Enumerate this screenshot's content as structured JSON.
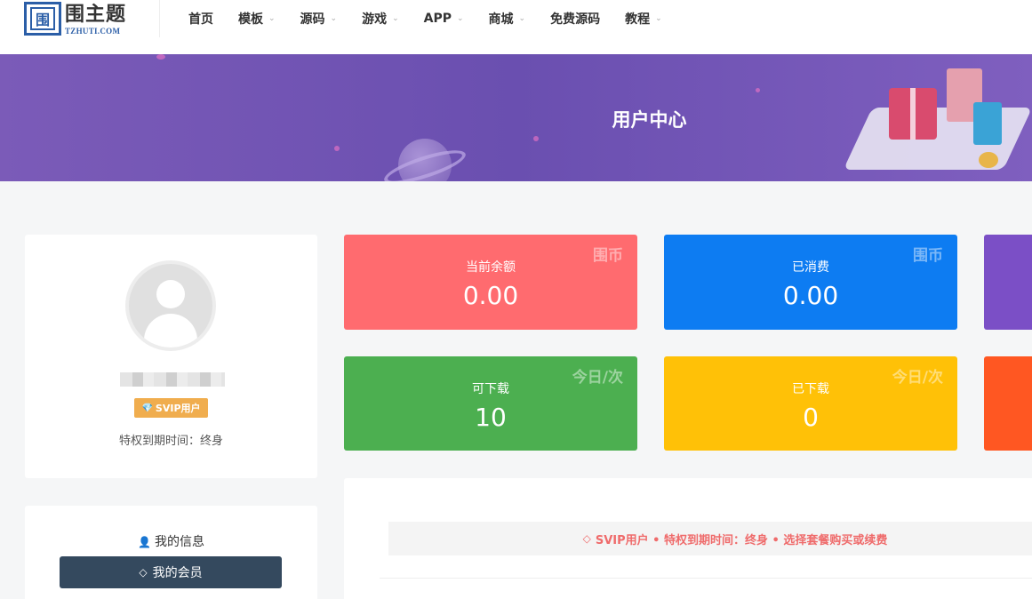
{
  "header": {
    "logo_glyph": "围",
    "logo_name": "围主题",
    "logo_sub": "TZHUTI.COM",
    "nav": [
      {
        "label": "首页",
        "has_dropdown": false
      },
      {
        "label": "模板",
        "has_dropdown": true
      },
      {
        "label": "源码",
        "has_dropdown": true
      },
      {
        "label": "游戏",
        "has_dropdown": true
      },
      {
        "label": "APP",
        "has_dropdown": true
      },
      {
        "label": "商城",
        "has_dropdown": true
      },
      {
        "label": "免费源码",
        "has_dropdown": false
      },
      {
        "label": "教程",
        "has_dropdown": true
      }
    ]
  },
  "banner": {
    "title": "用户中心"
  },
  "profile": {
    "badge": "SVIP用户",
    "expire_text": "特权到期时间：终身"
  },
  "menu": {
    "info_label": "我的信息",
    "member_button": "我的会员"
  },
  "stats": {
    "balance": {
      "corner": "围币",
      "label": "当前余额",
      "value": "0.00"
    },
    "spent": {
      "corner": "围币",
      "label": "已消费",
      "value": "0.00"
    },
    "downloadable": {
      "corner": "今日/次",
      "label": "可下载",
      "value": "10"
    },
    "downloaded": {
      "corner": "今日/次",
      "label": "已下载",
      "value": "0"
    }
  },
  "notice": {
    "text": "SVIP用户 • 特权到期时间：终身 • 选择套餐购买或续费"
  },
  "colors": {
    "red": "#ff6b6f",
    "blue": "#0d7cf2",
    "green": "#4caf50",
    "yellow": "#ffc107",
    "purple": "#7b4fc6",
    "orange": "#ff5722",
    "badge": "#f0ad4e",
    "button": "#34495e"
  }
}
